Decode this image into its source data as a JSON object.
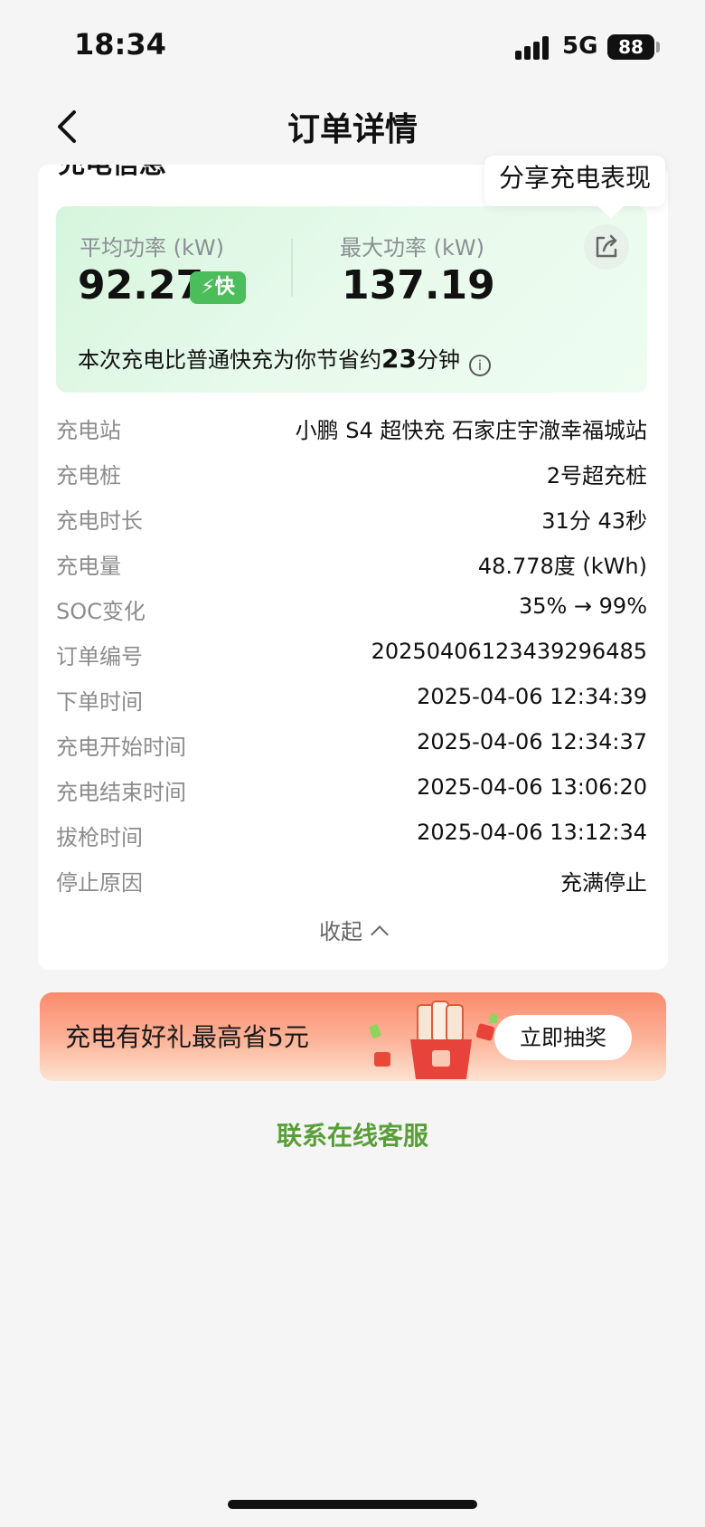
{
  "status_bar": {
    "time": "18:34",
    "network": "5G",
    "battery": "88"
  },
  "nav": {
    "title": "订单详情"
  },
  "card": {
    "section_title": "充电信息",
    "share_tip": "分享充电表现",
    "avg_power_label": "平均功率 (kW)",
    "avg_power_value": "92.27",
    "fast_badge": "⚡快",
    "max_power_label": "最大功率 (kW)",
    "max_power_value": "137.19",
    "save_prefix": "本次充电比普通快充为你节省约",
    "save_minutes": "23",
    "save_suffix": "分钟",
    "info_icon": "i"
  },
  "details": [
    {
      "label": "充电站",
      "value": "小鹏 S4 超快充 石家庄宇澈幸福城站"
    },
    {
      "label": "充电桩",
      "value": "2号超充桩"
    },
    {
      "label": "充电时长",
      "value": "31分 43秒"
    },
    {
      "label": "充电量",
      "value": "48.778度 (kWh)"
    },
    {
      "label": "SOC变化",
      "value": "35% → 99%"
    },
    {
      "label": "订单编号",
      "value": "2025040612343929648​5"
    },
    {
      "label": "下单时间",
      "value": "2025-04-06 12:34:39"
    },
    {
      "label": "充电开始时间",
      "value": "2025-04-06 12:34:37"
    },
    {
      "label": "充电结束时间",
      "value": "2025-04-06 13:06:20"
    },
    {
      "label": "拔枪时间",
      "value": "2025-04-06 13:12:34"
    },
    {
      "label": "停止原因",
      "value": "充满停止"
    }
  ],
  "collapse_label": "收起",
  "banner": {
    "text": "充电有好礼最高省5元",
    "button": "立即抽奖"
  },
  "contact_label": "联系在线客服",
  "colors": {
    "accent_green": "#5a9e3a",
    "badge_green": "#4bbd5a",
    "banner_orange": "#fb8b6d"
  }
}
